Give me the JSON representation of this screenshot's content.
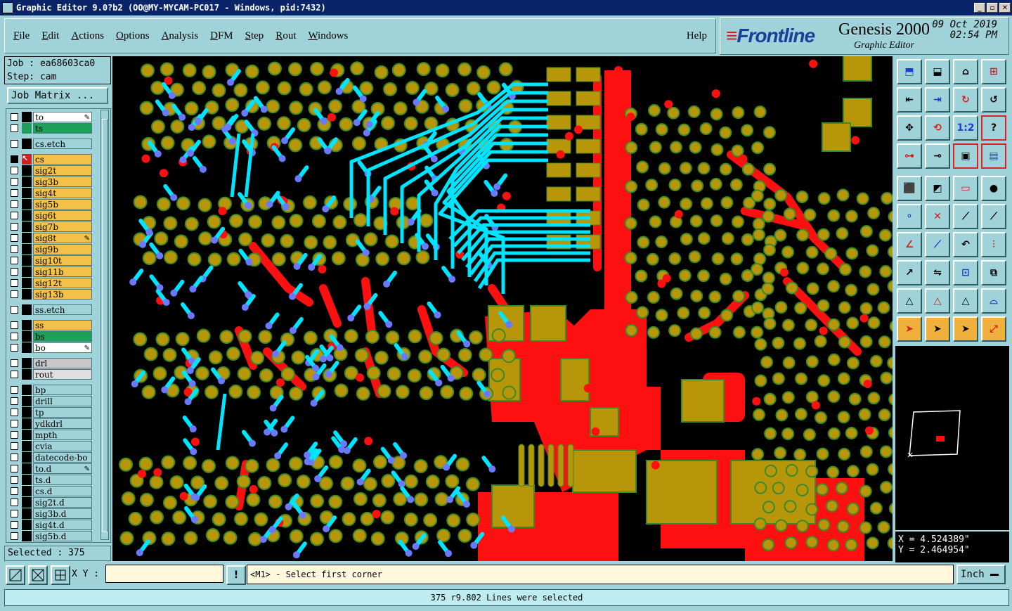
{
  "window": {
    "title": "Graphic Editor 9.0?b2 (OO@MY-MYCAM-PC017 - Windows, pid:7432)"
  },
  "menu": {
    "items": [
      {
        "label": "File",
        "key": "F"
      },
      {
        "label": "Edit",
        "key": "E"
      },
      {
        "label": "Actions",
        "key": "A"
      },
      {
        "label": "Options",
        "key": "O"
      },
      {
        "label": "Analysis",
        "key": "A"
      },
      {
        "label": "DFM",
        "key": "D"
      },
      {
        "label": "Step",
        "key": "S"
      },
      {
        "label": "Rout",
        "key": "R"
      },
      {
        "label": "Windows",
        "key": "W"
      }
    ],
    "help": "Help"
  },
  "brand": {
    "logo": "Frontline",
    "product": "Genesis 2000",
    "subtitle": "Graphic Editor",
    "date": "09 Oct 2019",
    "time": "02:54 PM"
  },
  "job": {
    "job_line": "Job : ea68603ca0",
    "step_line": "Step: cam",
    "matrix_button": "Job Matrix ..."
  },
  "layers": [
    {
      "name": "to",
      "color": "#ffffff",
      "swatch": "#000000",
      "icon": true
    },
    {
      "name": "ts",
      "color": "#1fa05a",
      "swatch": "#1fa05a"
    },
    {
      "name": "cs.etch",
      "color": "#9fd3d9",
      "swatch": "#000000"
    },
    {
      "name": "cs",
      "color": "#f3c14a",
      "swatch": "#d22020",
      "active": true
    },
    {
      "name": "sig2t",
      "color": "#f3c14a",
      "swatch": "#000000"
    },
    {
      "name": "sig3b",
      "color": "#f3c14a",
      "swatch": "#000000"
    },
    {
      "name": "sig4t",
      "color": "#f3c14a",
      "swatch": "#000000"
    },
    {
      "name": "sig5b",
      "color": "#f3c14a",
      "swatch": "#000000"
    },
    {
      "name": "sig6t",
      "color": "#f3c14a",
      "swatch": "#000000"
    },
    {
      "name": "sig7b",
      "color": "#f3c14a",
      "swatch": "#000000"
    },
    {
      "name": "sig8t",
      "color": "#f3c14a",
      "swatch": "#000000",
      "icon": true
    },
    {
      "name": "sig9b",
      "color": "#f3c14a",
      "swatch": "#000000"
    },
    {
      "name": "sig10t",
      "color": "#f3c14a",
      "swatch": "#000000"
    },
    {
      "name": "sig11b",
      "color": "#f3c14a",
      "swatch": "#000000"
    },
    {
      "name": "sig12t",
      "color": "#f3c14a",
      "swatch": "#000000"
    },
    {
      "name": "sig13b",
      "color": "#f3c14a",
      "swatch": "#000000"
    },
    {
      "name": "ss.etch",
      "color": "#9fd3d9",
      "swatch": "#000000"
    },
    {
      "name": "ss",
      "color": "#f3c14a",
      "swatch": "#000000"
    },
    {
      "name": "bs",
      "color": "#1fa05a",
      "swatch": "#000000"
    },
    {
      "name": "bo",
      "color": "#ffffff",
      "swatch": "#000000",
      "icon": true
    },
    {
      "name": "drl",
      "color": "#c8c8c8",
      "swatch": "#000000"
    },
    {
      "name": "rout",
      "color": "#e0e0e0",
      "swatch": "#000000"
    },
    {
      "name": "bp",
      "color": "#9fd3d9",
      "swatch": "#000000"
    },
    {
      "name": "drill",
      "color": "#9fd3d9",
      "swatch": "#000000"
    },
    {
      "name": "tp",
      "color": "#9fd3d9",
      "swatch": "#000000"
    },
    {
      "name": "ydkdrl",
      "color": "#9fd3d9",
      "swatch": "#000000"
    },
    {
      "name": "mpth",
      "color": "#9fd3d9",
      "swatch": "#000000"
    },
    {
      "name": "cvia",
      "color": "#9fd3d9",
      "swatch": "#000000"
    },
    {
      "name": "datecode-bo",
      "color": "#9fd3d9",
      "swatch": "#000000"
    },
    {
      "name": "to.d",
      "color": "#9fd3d9",
      "swatch": "#000000",
      "icon": true
    },
    {
      "name": "ts.d",
      "color": "#9fd3d9",
      "swatch": "#000000"
    },
    {
      "name": "cs.d",
      "color": "#9fd3d9",
      "swatch": "#000000"
    },
    {
      "name": "sig2t.d",
      "color": "#9fd3d9",
      "swatch": "#000000"
    },
    {
      "name": "sig3b.d",
      "color": "#9fd3d9",
      "swatch": "#000000"
    },
    {
      "name": "sig4t.d",
      "color": "#9fd3d9",
      "swatch": "#000000"
    },
    {
      "name": "sig5b.d",
      "color": "#9fd3d9",
      "swatch": "#000000"
    }
  ],
  "selected_text": "Selected : 375",
  "coords": {
    "x": "X = 4.524389\"",
    "y": "Y = 2.464954\""
  },
  "input": {
    "xy_label": "X Y :",
    "xy_value": ""
  },
  "prompt_text": "<M1> - Select first corner",
  "units": "Inch",
  "status_text": "375 r9.802 Lines were selected",
  "colors": {
    "pad": "#b8960a",
    "pad_outline": "#3a8a2a",
    "copper": "#ff1010",
    "selected": "#00e5ff",
    "via_line": "#6a7aff"
  },
  "toolbar": [
    "zoom-home-icon",
    "zoom-fit-icon",
    "zoom-profile-icon",
    "zoom-window-icon",
    "pan-left-icon",
    "pan-right-icon",
    "zoom-out-icon",
    "zoom-in-icon",
    "pan-center-icon",
    "redraw-icon",
    "scale-1to2-icon",
    "query-icon",
    "snap-icon",
    "measure-icon",
    "layers-compare-icon",
    "layers-graph-icon",
    "fill-icon",
    "polygon-icon",
    "ruler-icon",
    "pad-icon",
    "connect-icon",
    "cross-icon",
    "line-node-icon",
    "arc-node-icon",
    "draw-line-icon",
    "draw-arc-icon",
    "undo-rotate-icon",
    "flip-icon",
    "move-icon",
    "mirror-icon",
    "resize-icon",
    "copy-icon",
    "contour-icon",
    "peak-icon",
    "arch-icon",
    "bridge-icon",
    "select-icon",
    "select-box-icon",
    "select-rotate-icon",
    "select-net-icon"
  ]
}
